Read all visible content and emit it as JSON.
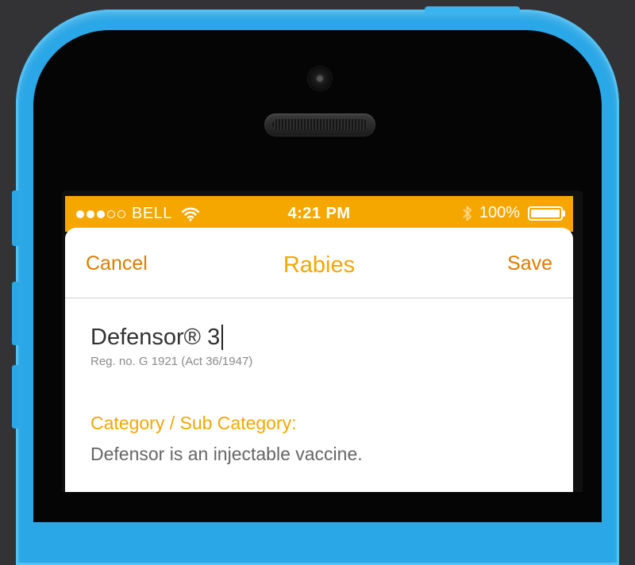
{
  "status_bar": {
    "carrier": "BELL",
    "signal_strength": 3,
    "signal_max": 5,
    "time": "4:21 PM",
    "battery": "100%",
    "battery_level": 1.0,
    "icons": [
      "wifi-icon",
      "bluetooth-icon",
      "battery-icon"
    ],
    "background_color": "#f5a700"
  },
  "nav": {
    "cancel_label": "Cancel",
    "title": "Rabies",
    "save_label": "Save"
  },
  "form": {
    "product_name": "Defensor® 3",
    "registration": "Reg. no. G 1921 (Act 36/1947)",
    "category_label": "Category / Sub Category:",
    "category_value": "Defensor is an injectable vaccine."
  },
  "colors": {
    "accent": "#f5a700",
    "action": "#e07b00",
    "phone_body": "#2aa7e6"
  }
}
